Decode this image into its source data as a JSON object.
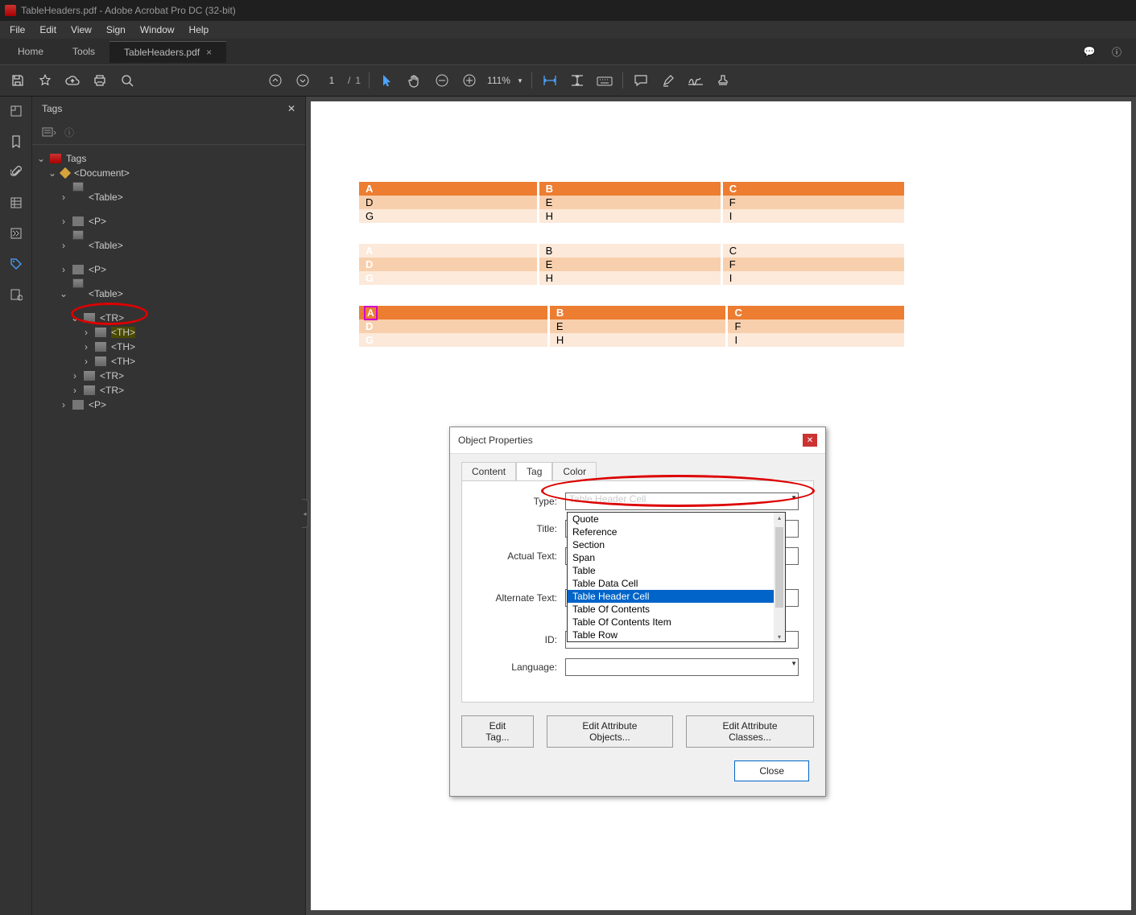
{
  "titlebar": {
    "text": "TableHeaders.pdf - Adobe Acrobat Pro DC (32-bit)"
  },
  "menubar": [
    "File",
    "Edit",
    "View",
    "Sign",
    "Window",
    "Help"
  ],
  "tabs": {
    "home": "Home",
    "tools": "Tools",
    "doc": "TableHeaders.pdf"
  },
  "toolbar": {
    "page_cur": "1",
    "page_sep": "/",
    "page_tot": "1",
    "zoom": "111%"
  },
  "panel": {
    "title": "Tags",
    "close": "✕"
  },
  "tree": {
    "root": "Tags",
    "document": "<Document>",
    "table1": "<Table>",
    "p1": "<P>",
    "table2": "<Table>",
    "p2": "<P>",
    "table3": "<Table>",
    "tr1": "<TR>",
    "th1": "<TH>",
    "th2": "<TH>",
    "th3": "<TH>",
    "tr2": "<TR>",
    "tr3": "<TR>",
    "p3": "<P>"
  },
  "doc_tables": [
    {
      "rows": [
        [
          "A",
          "B",
          "C"
        ],
        [
          "D",
          "E",
          "F"
        ],
        [
          "G",
          "H",
          "I"
        ]
      ],
      "style": "row_header"
    },
    {
      "rows": [
        [
          "A",
          "B",
          "C"
        ],
        [
          "D",
          "E",
          "F"
        ],
        [
          "G",
          "H",
          "I"
        ]
      ],
      "style": "col_header"
    },
    {
      "rows": [
        [
          "A",
          "B",
          "C"
        ],
        [
          "D",
          "E",
          "F"
        ],
        [
          "G",
          "H",
          "I"
        ]
      ],
      "style": "both_header"
    }
  ],
  "dialog": {
    "title": "Object Properties",
    "tabs": [
      "Content",
      "Tag",
      "Color"
    ],
    "active_tab": "Tag",
    "fields": {
      "type_lbl": "Type:",
      "type_val": "Table Header Cell",
      "title_lbl": "Title:",
      "actual_lbl": "Actual Text:",
      "alt_lbl": "Alternate Text:",
      "id_lbl": "ID:",
      "lang_lbl": "Language:"
    },
    "dropdown_options": [
      "Quote",
      "Reference",
      "Section",
      "Span",
      "Table",
      "Table Data Cell",
      "Table Header Cell",
      "Table Of Contents",
      "Table Of Contents Item",
      "Table Row"
    ],
    "dropdown_selected": "Table Header Cell",
    "buttons": {
      "edit_tag": "Edit Tag...",
      "edit_attr_obj": "Edit Attribute Objects...",
      "edit_attr_cls": "Edit Attribute Classes...",
      "close": "Close"
    }
  }
}
